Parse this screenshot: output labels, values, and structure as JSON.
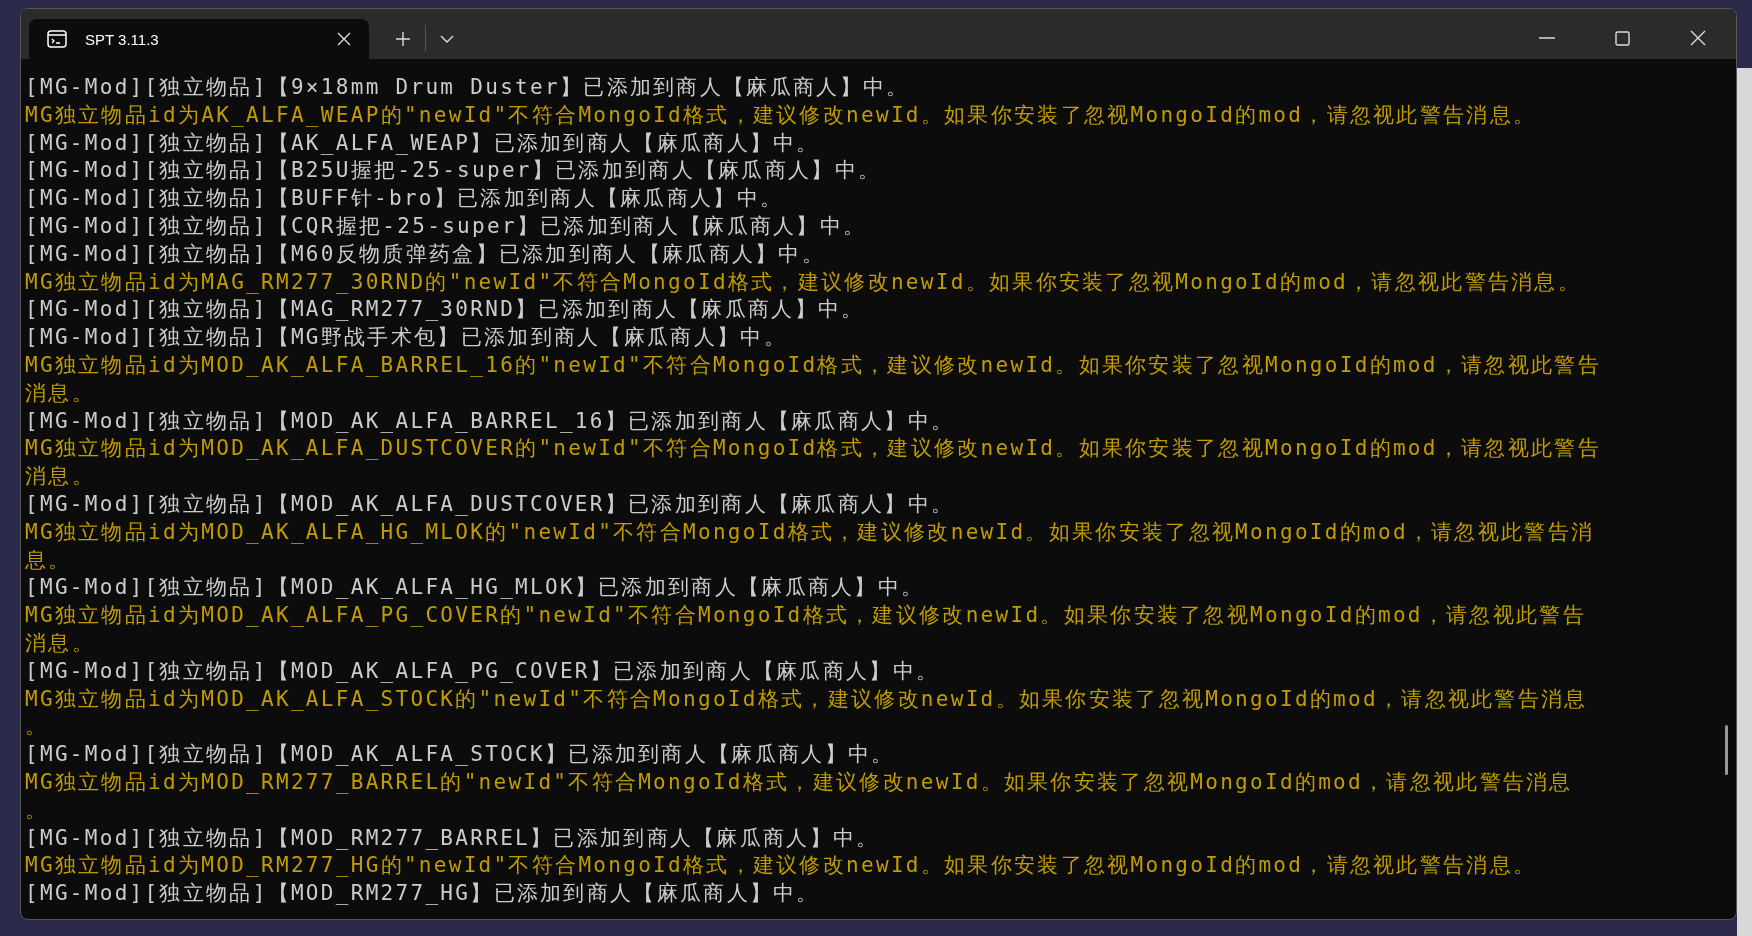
{
  "window": {
    "tab": {
      "title": "SPT 3.11.3",
      "selected": true
    }
  },
  "lines": [
    {
      "kind": "log",
      "text": "[MG-Mod][独立物品]【9×18mm Drum Duster】已添加到商人【麻瓜商人】中。"
    },
    {
      "kind": "warning",
      "text": "MG独立物品id为AK_ALFA_WEAP的\"newId\"不符合MongoId格式，建议修改newId。如果你安装了忽视MongoId的mod，请忽视此警告消息。"
    },
    {
      "kind": "log",
      "text": "[MG-Mod][独立物品]【AK_ALFA_WEAP】已添加到商人【麻瓜商人】中。"
    },
    {
      "kind": "log",
      "text": "[MG-Mod][独立物品]【B25U握把-25-super】已添加到商人【麻瓜商人】中。"
    },
    {
      "kind": "log",
      "text": "[MG-Mod][独立物品]【BUFF针-bro】已添加到商人【麻瓜商人】中。"
    },
    {
      "kind": "log",
      "text": "[MG-Mod][独立物品]【CQR握把-25-super】已添加到商人【麻瓜商人】中。"
    },
    {
      "kind": "log",
      "text": "[MG-Mod][独立物品]【M60反物质弹药盒】已添加到商人【麻瓜商人】中。"
    },
    {
      "kind": "warning",
      "text": "MG独立物品id为MAG_RM277_30RND的\"newId\"不符合MongoId格式，建议修改newId。如果你安装了忽视MongoId的mod，请忽视此警告消息。"
    },
    {
      "kind": "log",
      "text": "[MG-Mod][独立物品]【MAG_RM277_30RND】已添加到商人【麻瓜商人】中。"
    },
    {
      "kind": "log",
      "text": "[MG-Mod][独立物品]【MG野战手术包】已添加到商人【麻瓜商人】中。"
    },
    {
      "kind": "warning",
      "text": "MG独立物品id为MOD_AK_ALFA_BARREL_16的\"newId\"不符合MongoId格式，建议修改newId。如果你安装了忽视MongoId的mod，请忽视此警告"
    },
    {
      "kind": "warning",
      "text": "消息。"
    },
    {
      "kind": "log",
      "text": "[MG-Mod][独立物品]【MOD_AK_ALFA_BARREL_16】已添加到商人【麻瓜商人】中。"
    },
    {
      "kind": "warning",
      "text": "MG独立物品id为MOD_AK_ALFA_DUSTCOVER的\"newId\"不符合MongoId格式，建议修改newId。如果你安装了忽视MongoId的mod，请忽视此警告"
    },
    {
      "kind": "warning",
      "text": "消息。"
    },
    {
      "kind": "log",
      "text": "[MG-Mod][独立物品]【MOD_AK_ALFA_DUSTCOVER】已添加到商人【麻瓜商人】中。"
    },
    {
      "kind": "warning",
      "text": "MG独立物品id为MOD_AK_ALFA_HG_MLOK的\"newId\"不符合MongoId格式，建议修改newId。如果你安装了忽视MongoId的mod，请忽视此警告消"
    },
    {
      "kind": "warning",
      "text": "息。"
    },
    {
      "kind": "log",
      "text": "[MG-Mod][独立物品]【MOD_AK_ALFA_HG_MLOK】已添加到商人【麻瓜商人】中。"
    },
    {
      "kind": "warning",
      "text": "MG独立物品id为MOD_AK_ALFA_PG_COVER的\"newId\"不符合MongoId格式，建议修改newId。如果你安装了忽视MongoId的mod，请忽视此警告"
    },
    {
      "kind": "warning",
      "text": "消息。"
    },
    {
      "kind": "log",
      "text": "[MG-Mod][独立物品]【MOD_AK_ALFA_PG_COVER】已添加到商人【麻瓜商人】中。"
    },
    {
      "kind": "warning",
      "text": "MG独立物品id为MOD_AK_ALFA_STOCK的\"newId\"不符合MongoId格式，建议修改newId。如果你安装了忽视MongoId的mod，请忽视此警告消息"
    },
    {
      "kind": "warning",
      "text": "。"
    },
    {
      "kind": "log",
      "text": "[MG-Mod][独立物品]【MOD_AK_ALFA_STOCK】已添加到商人【麻瓜商人】中。"
    },
    {
      "kind": "warning",
      "text": "MG独立物品id为MOD_RM277_BARREL的\"newId\"不符合MongoId格式，建议修改newId。如果你安装了忽视MongoId的mod，请忽视此警告消息"
    },
    {
      "kind": "warning",
      "text": "。"
    },
    {
      "kind": "log",
      "text": "[MG-Mod][独立物品]【MOD_RM277_BARREL】已添加到商人【麻瓜商人】中。"
    },
    {
      "kind": "warning",
      "text": "MG独立物品id为MOD_RM277_HG的\"newId\"不符合MongoId格式，建议修改newId。如果你安装了忽视MongoId的mod，请忽视此警告消息。"
    },
    {
      "kind": "log",
      "text": "[MG-Mod][独立物品]【MOD_RM277_HG】已添加到商人【麻瓜商人】中。"
    }
  ]
}
